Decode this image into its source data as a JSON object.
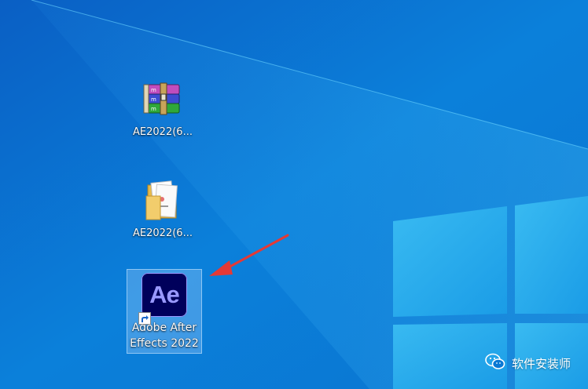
{
  "desktop": {
    "icons": [
      {
        "label": "AE2022(6...",
        "icon": "winrar-archive-icon"
      },
      {
        "label": "AE2022(6...",
        "icon": "folder-icon"
      },
      {
        "label": "Adobe After Effects 2022",
        "icon": "after-effects-icon",
        "badge": "Ae",
        "selected": true
      }
    ]
  },
  "watermark": {
    "text": "软件安装师",
    "icon": "wechat-icon"
  },
  "colors": {
    "accent": "#0a78d4",
    "ae_background": "#00005b",
    "ae_text": "#9999ff",
    "arrow": "#e53935"
  }
}
